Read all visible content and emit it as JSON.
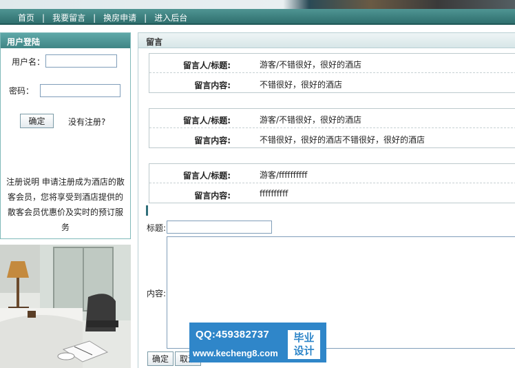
{
  "nav": {
    "items": [
      {
        "label": "首页"
      },
      {
        "label": "我要留言"
      },
      {
        "label": "换房申请"
      },
      {
        "label": "进入后台"
      }
    ],
    "separator": "|"
  },
  "login": {
    "title": "用户登陆",
    "username_label": "用户名：",
    "username_value": "",
    "password_label": "密码：",
    "password_value": "",
    "submit_label": "确定",
    "register_link": "没有注册?",
    "register_info": "注册说明 申请注册成为酒店的散客会员，您将享受到酒店提供的散客会员优惠价及实时的预订服务"
  },
  "messages": {
    "title": "留言",
    "author_label": "留言人/标题:",
    "content_label": "留言内容:",
    "items": [
      {
        "author_title": "游客/不错很好，很好的酒店",
        "content": "不错很好，很好的酒店"
      },
      {
        "author_title": "游客/不错很好，很好的酒店",
        "content": "不错很好，很好的酒店不错很好，很好的酒店"
      },
      {
        "author_title": "游客/ffffffffff",
        "content": "ffffffffff"
      }
    ]
  },
  "form": {
    "title_label": "标题:",
    "title_value": "",
    "content_label": "内容:",
    "content_value": "",
    "submit_label": "确定",
    "cancel_label": "取消"
  },
  "watermark": {
    "qq": "QQ:459382737",
    "url": "www.kecheng8.com",
    "badge_line1": "毕业",
    "badge_line2": "设计"
  },
  "colors": {
    "nav_bar": "#3f8382",
    "panel_header": "#4f9696",
    "watermark": "#2f86c9"
  }
}
